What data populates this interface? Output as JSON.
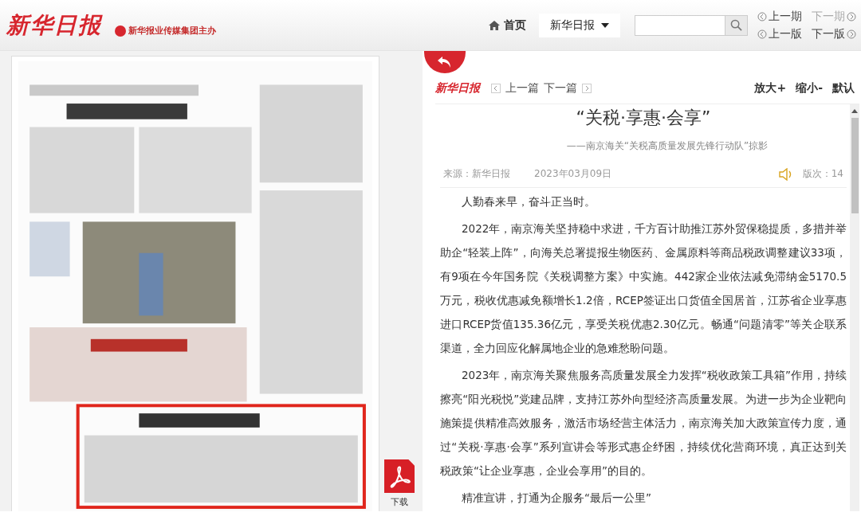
{
  "header": {
    "logo": "新华日报",
    "sponsor": "新华报业传媒集团主办",
    "home": "首页",
    "paper_select": "新华日报",
    "nav": [
      {
        "label": "上一期",
        "disabled": false,
        "kind": "previous"
      },
      {
        "label": "下一期",
        "disabled": true,
        "kind": "next"
      },
      {
        "label": "上一版",
        "disabled": false,
        "kind": "previous"
      },
      {
        "label": "下一版",
        "disabled": false,
        "kind": "next"
      }
    ]
  },
  "page_view": {
    "kind": "picture",
    "download": "下载"
  },
  "article_bar": {
    "logo": "新华日报",
    "prev": "上一篇",
    "next": "下一篇",
    "zoom_in": "放大+",
    "zoom_out": "缩小-",
    "reset": "默认"
  },
  "article": {
    "title": "“关税·享惠·会享”",
    "subtitle": "——南京海关“关税高质量发展先锋行动队”掠影",
    "source": "来源：新华日报",
    "date": "2023年03月09日",
    "edition": "版次：14",
    "paragraphs": [
      "人勤春来早，奋斗正当时。",
      "2022年，南京海关坚持稳中求进，千方百计助推江苏外贸保稳提质，多措并举助企“轻装上阵”，向海关总署提报生物医药、金属原料等商品税政调整建议33项，有9项在今年国务院《关税调整方案》中实施。442家企业依法减免滞纳金5170.5万元，税收优惠减免额增长1.2倍，RCEP签证出口货值全国居首，江苏省企业享惠进口RCEP货值135.36亿元，享受关税优惠2.30亿元。畅通“问题清零”等关企联系渠道，全力回应化解属地企业的急难愁盼问题。",
      "2023年，南京海关聚焦服务高质量发展全力发挥“税收政策工具箱”作用，持续擦亮“阳光税悦”党建品牌，支持江苏外向型经济高质量发展。为进一步为企业靶向施策提供精准高效服务，激活市场经营主体活力，南京海关加大政策宣传力度，通过“关税·享惠·会享”系列宣讲会等形式惠企纾困，持续优化营商环境，真正达到关税政策“让企业享惠，企业会享用”的目的。",
      "精准宣讲，打通为企服务“最后一公里”"
    ]
  }
}
